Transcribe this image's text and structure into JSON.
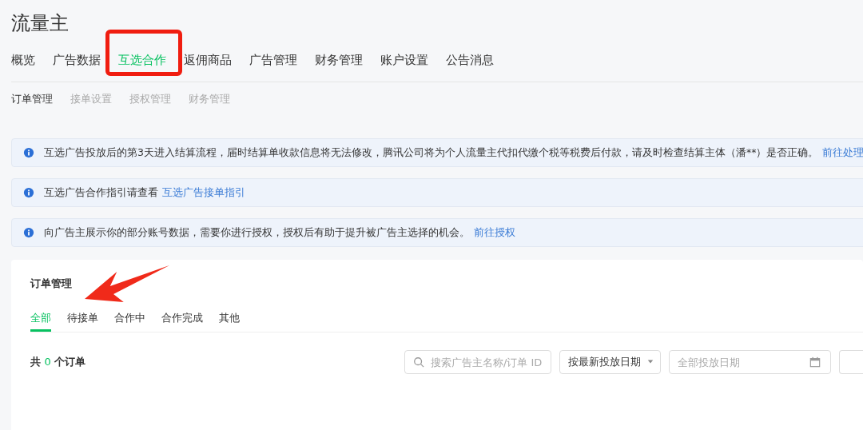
{
  "title": "流量主",
  "tabs": [
    {
      "label": "概览",
      "selected": false
    },
    {
      "label": "广告数据",
      "selected": false
    },
    {
      "label": "互选合作",
      "selected": true
    },
    {
      "label": "返佣商品",
      "selected": false
    },
    {
      "label": "广告管理",
      "selected": false
    },
    {
      "label": "财务管理",
      "selected": false
    },
    {
      "label": "账户设置",
      "selected": false
    },
    {
      "label": "公告消息",
      "selected": false
    }
  ],
  "subtabs": [
    {
      "label": "订单管理",
      "selected": true
    },
    {
      "label": "接单设置",
      "selected": false
    },
    {
      "label": "授权管理",
      "selected": false
    },
    {
      "label": "财务管理",
      "selected": false
    }
  ],
  "notices": [
    {
      "text": "互选广告投放后的第3天进入结算流程，届时结算单收款信息将无法修改，腾讯公司将为个人流量主代扣代缴个税等税费后付款，请及时检查结算主体（潘**）是否正确。",
      "link": "前往处理"
    },
    {
      "text": "互选广告合作指引请查看",
      "link": "互选广告接单指引"
    },
    {
      "text": "向广告主展示你的部分账号数据，需要你进行授权，授权后有助于提升被广告主选择的机会。",
      "link": "前往授权"
    }
  ],
  "orders": {
    "title": "订单管理",
    "tabs": [
      {
        "label": "全部",
        "selected": true
      },
      {
        "label": "待接单",
        "selected": false
      },
      {
        "label": "合作中",
        "selected": false
      },
      {
        "label": "合作完成",
        "selected": false
      },
      {
        "label": "其他",
        "selected": false
      }
    ],
    "count": {
      "prefix": "共",
      "value": "0",
      "suffix": "个订单"
    },
    "search": {
      "placeholder": "搜索广告主名称/订单 ID"
    },
    "sort": {
      "value": "按最新投放日期"
    },
    "date": {
      "placeholder": "全部投放日期"
    }
  }
}
